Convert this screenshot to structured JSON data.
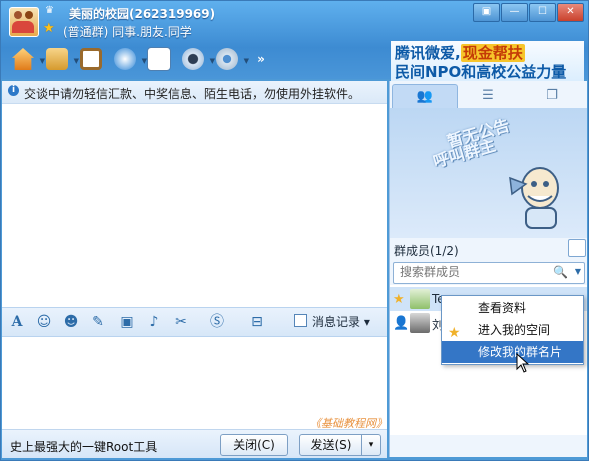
{
  "window": {
    "group_name": "美丽的校园(262319969)",
    "group_type": "(普通群) 同事.朋友.同学",
    "controls": [
      "▣",
      "—",
      "☐",
      "✕"
    ]
  },
  "toolbar": {
    "tools": [
      "group-home",
      "share-files",
      "album",
      "voice-chat",
      "send-message",
      "video",
      "settings"
    ],
    "more": "»"
  },
  "banner": {
    "line1_a": "腾讯微爱,",
    "line1_b": "现金帮扶",
    "line2": "民间NPO和高校公益力量"
  },
  "notice": {
    "text": "交谈中请勿轻信汇款、中奖信息、陌生电话，勿使用外挂软件。"
  },
  "format_bar": {
    "history_label": "消息记录",
    "history_arrow": "▾"
  },
  "watermark": "《基础教程网》",
  "bottom": {
    "ad_text": "史上最强大的一键Root工具",
    "close_label": "关闭(C)",
    "send_label": "发送(S)",
    "send_arrow": "▾"
  },
  "right": {
    "board_line1": "暂无公告",
    "board_line2": "呼叫群主",
    "members_title": "群成员(1/2)",
    "search_placeholder": "搜索群成员",
    "members": [
      {
        "name": "Te",
        "badge": "★"
      },
      {
        "name": "刘",
        "badge": "👤"
      }
    ]
  },
  "context_menu": {
    "items": [
      "查看资料",
      "进入我的空间",
      "修改我的群名片"
    ]
  },
  "colors": {
    "title_blue": "#3d8bd2",
    "menu_highlight": "#3476c6",
    "banner_text": "#0d5aa7"
  }
}
